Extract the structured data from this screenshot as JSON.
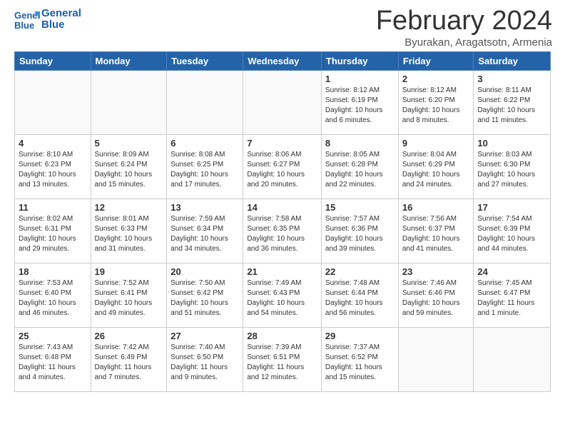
{
  "header": {
    "logo_line1": "General",
    "logo_line2": "Blue",
    "title": "February 2024",
    "subtitle": "Byurakan, Aragatsotn, Armenia"
  },
  "weekdays": [
    "Sunday",
    "Monday",
    "Tuesday",
    "Wednesday",
    "Thursday",
    "Friday",
    "Saturday"
  ],
  "weeks": [
    [
      {
        "day": "",
        "info": ""
      },
      {
        "day": "",
        "info": ""
      },
      {
        "day": "",
        "info": ""
      },
      {
        "day": "",
        "info": ""
      },
      {
        "day": "1",
        "info": "Sunrise: 8:12 AM\nSunset: 6:19 PM\nDaylight: 10 hours\nand 6 minutes."
      },
      {
        "day": "2",
        "info": "Sunrise: 8:12 AM\nSunset: 6:20 PM\nDaylight: 10 hours\nand 8 minutes."
      },
      {
        "day": "3",
        "info": "Sunrise: 8:11 AM\nSunset: 6:22 PM\nDaylight: 10 hours\nand 11 minutes."
      }
    ],
    [
      {
        "day": "4",
        "info": "Sunrise: 8:10 AM\nSunset: 6:23 PM\nDaylight: 10 hours\nand 13 minutes."
      },
      {
        "day": "5",
        "info": "Sunrise: 8:09 AM\nSunset: 6:24 PM\nDaylight: 10 hours\nand 15 minutes."
      },
      {
        "day": "6",
        "info": "Sunrise: 8:08 AM\nSunset: 6:25 PM\nDaylight: 10 hours\nand 17 minutes."
      },
      {
        "day": "7",
        "info": "Sunrise: 8:06 AM\nSunset: 6:27 PM\nDaylight: 10 hours\nand 20 minutes."
      },
      {
        "day": "8",
        "info": "Sunrise: 8:05 AM\nSunset: 6:28 PM\nDaylight: 10 hours\nand 22 minutes."
      },
      {
        "day": "9",
        "info": "Sunrise: 8:04 AM\nSunset: 6:29 PM\nDaylight: 10 hours\nand 24 minutes."
      },
      {
        "day": "10",
        "info": "Sunrise: 8:03 AM\nSunset: 6:30 PM\nDaylight: 10 hours\nand 27 minutes."
      }
    ],
    [
      {
        "day": "11",
        "info": "Sunrise: 8:02 AM\nSunset: 6:31 PM\nDaylight: 10 hours\nand 29 minutes."
      },
      {
        "day": "12",
        "info": "Sunrise: 8:01 AM\nSunset: 6:33 PM\nDaylight: 10 hours\nand 31 minutes."
      },
      {
        "day": "13",
        "info": "Sunrise: 7:59 AM\nSunset: 6:34 PM\nDaylight: 10 hours\nand 34 minutes."
      },
      {
        "day": "14",
        "info": "Sunrise: 7:58 AM\nSunset: 6:35 PM\nDaylight: 10 hours\nand 36 minutes."
      },
      {
        "day": "15",
        "info": "Sunrise: 7:57 AM\nSunset: 6:36 PM\nDaylight: 10 hours\nand 39 minutes."
      },
      {
        "day": "16",
        "info": "Sunrise: 7:56 AM\nSunset: 6:37 PM\nDaylight: 10 hours\nand 41 minutes."
      },
      {
        "day": "17",
        "info": "Sunrise: 7:54 AM\nSunset: 6:39 PM\nDaylight: 10 hours\nand 44 minutes."
      }
    ],
    [
      {
        "day": "18",
        "info": "Sunrise: 7:53 AM\nSunset: 6:40 PM\nDaylight: 10 hours\nand 46 minutes."
      },
      {
        "day": "19",
        "info": "Sunrise: 7:52 AM\nSunset: 6:41 PM\nDaylight: 10 hours\nand 49 minutes."
      },
      {
        "day": "20",
        "info": "Sunrise: 7:50 AM\nSunset: 6:42 PM\nDaylight: 10 hours\nand 51 minutes."
      },
      {
        "day": "21",
        "info": "Sunrise: 7:49 AM\nSunset: 6:43 PM\nDaylight: 10 hours\nand 54 minutes."
      },
      {
        "day": "22",
        "info": "Sunrise: 7:48 AM\nSunset: 6:44 PM\nDaylight: 10 hours\nand 56 minutes."
      },
      {
        "day": "23",
        "info": "Sunrise: 7:46 AM\nSunset: 6:46 PM\nDaylight: 10 hours\nand 59 minutes."
      },
      {
        "day": "24",
        "info": "Sunrise: 7:45 AM\nSunset: 6:47 PM\nDaylight: 11 hours\nand 1 minute."
      }
    ],
    [
      {
        "day": "25",
        "info": "Sunrise: 7:43 AM\nSunset: 6:48 PM\nDaylight: 11 hours\nand 4 minutes."
      },
      {
        "day": "26",
        "info": "Sunrise: 7:42 AM\nSunset: 6:49 PM\nDaylight: 11 hours\nand 7 minutes."
      },
      {
        "day": "27",
        "info": "Sunrise: 7:40 AM\nSunset: 6:50 PM\nDaylight: 11 hours\nand 9 minutes."
      },
      {
        "day": "28",
        "info": "Sunrise: 7:39 AM\nSunset: 6:51 PM\nDaylight: 11 hours\nand 12 minutes."
      },
      {
        "day": "29",
        "info": "Sunrise: 7:37 AM\nSunset: 6:52 PM\nDaylight: 11 hours\nand 15 minutes."
      },
      {
        "day": "",
        "info": ""
      },
      {
        "day": "",
        "info": ""
      }
    ]
  ]
}
